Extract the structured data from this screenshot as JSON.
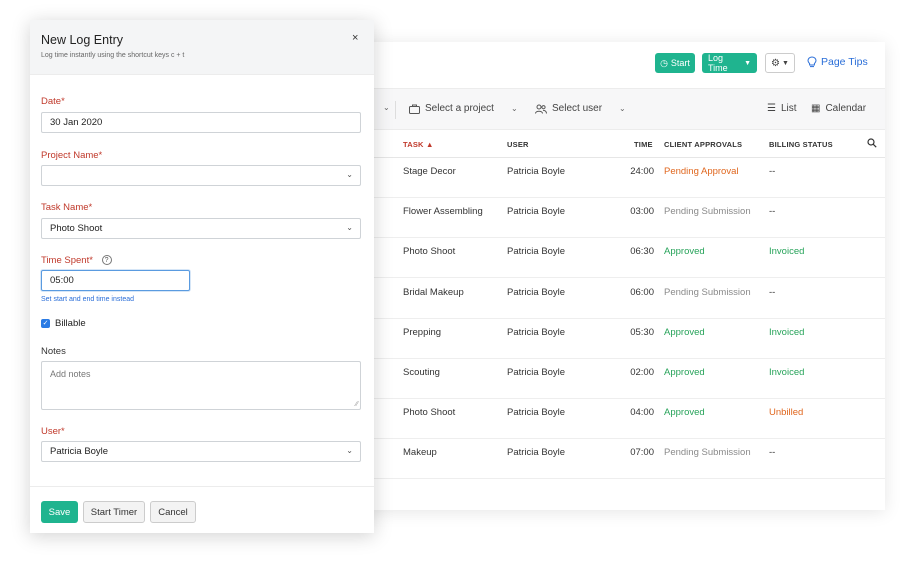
{
  "topbar": {
    "start_label": "Start",
    "logtime_label": "Log Time",
    "page_tips_label": "Page Tips"
  },
  "filters": {
    "project_label": "Select a project",
    "user_label": "Select user",
    "list_label": "List",
    "calendar_label": "Calendar"
  },
  "table": {
    "headers": {
      "task": "TASK",
      "user": "USER",
      "time": "TIME",
      "client_approvals": "CLIENT APPROVALS",
      "billing_status": "BILLING STATUS"
    },
    "rows": [
      {
        "task": "Stage Decor",
        "user": "Patricia Boyle",
        "time": "24:00",
        "approval": "Pending Approval",
        "billing": "--"
      },
      {
        "task": "Flower Assembling",
        "user": "Patricia Boyle",
        "time": "03:00",
        "approval": "Pending Submission",
        "billing": "--"
      },
      {
        "task": "Photo Shoot",
        "user": "Patricia Boyle",
        "time": "06:30",
        "approval": "Approved",
        "billing": "Invoiced"
      },
      {
        "task": "Bridal Makeup",
        "user": "Patricia Boyle",
        "time": "06:00",
        "approval": "Pending Submission",
        "billing": "--"
      },
      {
        "task": "Prepping",
        "user": "Patricia Boyle",
        "time": "05:30",
        "approval": "Approved",
        "billing": "Invoiced"
      },
      {
        "task": "Scouting",
        "user": "Patricia Boyle",
        "time": "02:00",
        "approval": "Approved",
        "billing": "Invoiced"
      },
      {
        "task": "Photo Shoot",
        "user": "Patricia Boyle",
        "time": "04:00",
        "approval": "Approved",
        "billing": "Unbilled"
      },
      {
        "task": "Makeup",
        "user": "Patricia Boyle",
        "time": "07:00",
        "approval": "Pending Submission",
        "billing": "--"
      }
    ]
  },
  "colors": {
    "Pending Approval": "#e0671f",
    "Pending Submission": "#8a8a8a",
    "Approved": "#27a35a",
    "Invoiced": "#27a35a",
    "Unbilled": "#e0671f",
    "--": "#333333"
  },
  "modal": {
    "title": "New Log Entry",
    "subtitle": "Log time instantly using the shortcut keys c + t",
    "close": "×",
    "date_label": "Date*",
    "date_value": "30 Jan 2020",
    "project_label": "Project Name*",
    "project_value": "",
    "task_label": "Task Name*",
    "task_value": "Photo Shoot",
    "time_label": "Time Spent*",
    "time_value": "05:00",
    "time_link": "Set start and end time instead",
    "billable_label": "Billable",
    "notes_label": "Notes",
    "notes_placeholder": "Add notes",
    "user_label": "User*",
    "user_value": "Patricia Boyle",
    "save_label": "Save",
    "start_timer_label": "Start Timer",
    "cancel_label": "Cancel"
  }
}
